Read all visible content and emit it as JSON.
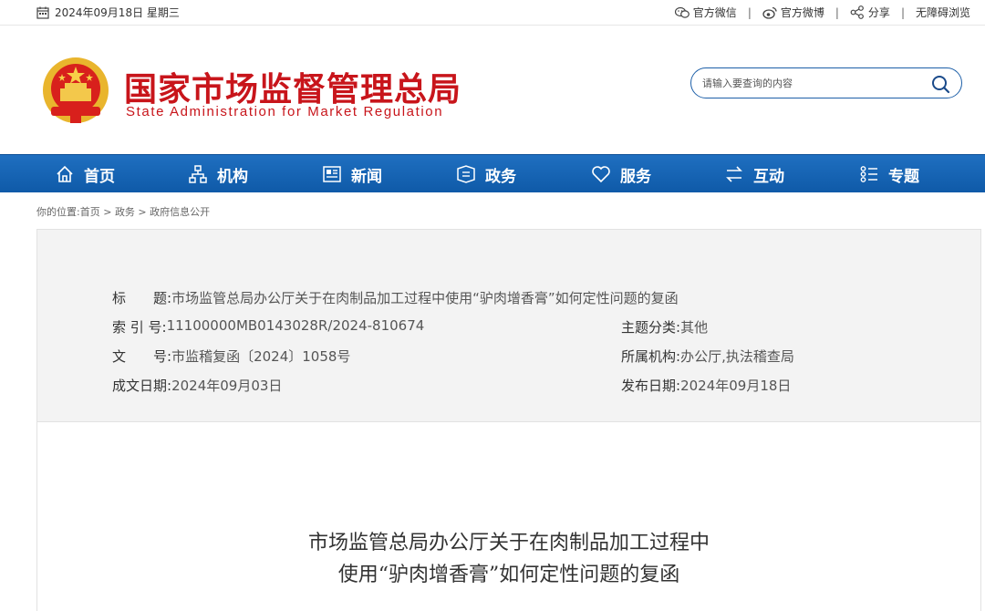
{
  "topbar": {
    "date": "2024年09月18日 星期三",
    "links": [
      {
        "label": "官方微信",
        "icon": "wechat-icon"
      },
      {
        "label": "官方微博",
        "icon": "weibo-icon"
      },
      {
        "label": "分享",
        "icon": "share-icon"
      },
      {
        "label": "无障碍浏览",
        "icon": ""
      }
    ],
    "separator": "|"
  },
  "header": {
    "title_cn": "国家市场监督管理总局",
    "title_en": "State Administration for Market Regulation",
    "search_placeholder": "请输入要查询的内容"
  },
  "nav": {
    "items": [
      {
        "label": "首页",
        "icon": "home-icon"
      },
      {
        "label": "机构",
        "icon": "org-chart-icon"
      },
      {
        "label": "新闻",
        "icon": "newspaper-icon"
      },
      {
        "label": "政务",
        "icon": "affairs-icon"
      },
      {
        "label": "服务",
        "icon": "heart-icon"
      },
      {
        "label": "互动",
        "icon": "exchange-icon"
      },
      {
        "label": "专题",
        "icon": "topics-icon"
      }
    ]
  },
  "breadcrumb": {
    "prefix": "你的位置:",
    "items": [
      "首页",
      "政务",
      "政府信息公开"
    ],
    "separator": " > "
  },
  "meta": {
    "title_label": "标　　题:",
    "title_value": "市场监管总局办公厅关于在肉制品加工过程中使用“驴肉增香膏”如何定性问题的复函",
    "index_label": "索 引 号:",
    "index_value": "11100000MB0143028R/2024-810674",
    "category_label": "主题分类:",
    "category_value": "其他",
    "docno_label": "文　　号:",
    "docno_value": "市监稽复函〔2024〕1058号",
    "org_label": "所属机构:",
    "org_value": "办公厅,执法稽查局",
    "written_label": "成文日期:",
    "written_value": "2024年09月03日",
    "published_label": "发布日期:",
    "published_value": "2024年09月18日"
  },
  "document": {
    "title_line1": "市场监管总局办公厅关于在肉制品加工过程中",
    "title_line2": "使用“驴肉增香膏”如何定性问题的复函"
  },
  "colors": {
    "brand_red": "#c8151b",
    "nav_blue": "#1565b4",
    "meta_bg": "#f3f3f3"
  }
}
